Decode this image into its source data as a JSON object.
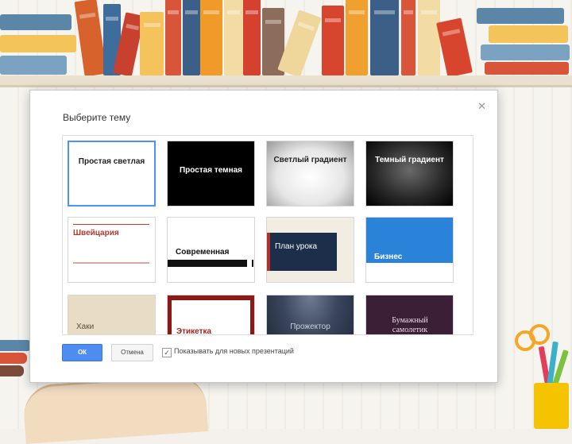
{
  "dialog": {
    "title": "Выберите тему",
    "close_icon": "close-icon",
    "ok_label": "ОК",
    "cancel_label": "Отмена",
    "checkbox_label": "Показывать для новых презентаций",
    "checkbox_checked": true,
    "themes": [
      {
        "label": "Простая светлая",
        "selected": true
      },
      {
        "label": "Простая темная",
        "selected": false
      },
      {
        "label": "Светлый градиент",
        "selected": false
      },
      {
        "label": "Темный градиент",
        "selected": false
      },
      {
        "label": "Швейцария",
        "selected": false
      },
      {
        "label": "Современная",
        "selected": false
      },
      {
        "label": "План урока",
        "selected": false
      },
      {
        "label": "Бизнес",
        "selected": false
      },
      {
        "label": "Хаки",
        "selected": false
      },
      {
        "label": "Этикетка",
        "selected": false
      },
      {
        "label": "Прожектор",
        "selected": false
      },
      {
        "label": "Бумажный самолетик",
        "selected": false
      }
    ]
  },
  "colors": {
    "accent": "#4d8cf0",
    "selected_border": "#4d90fe"
  }
}
